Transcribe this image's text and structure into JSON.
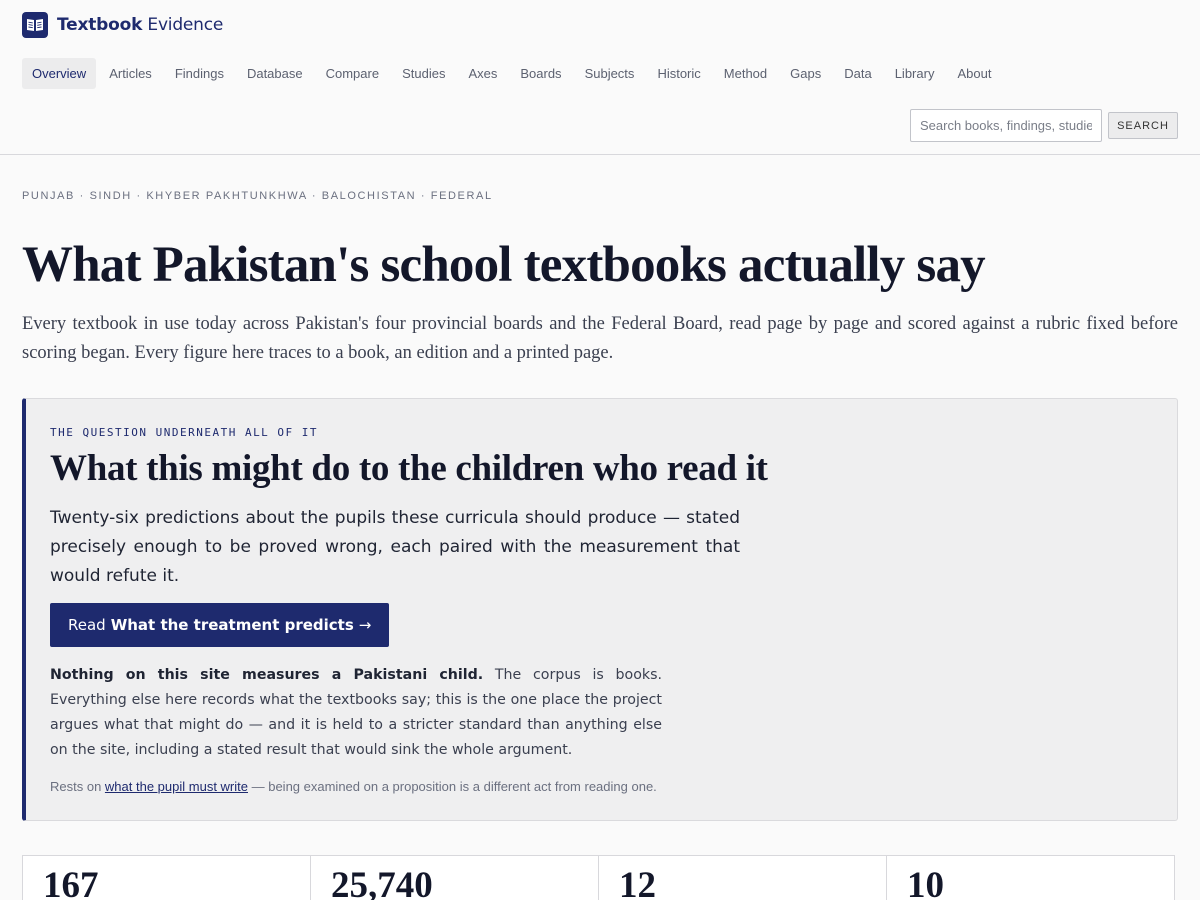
{
  "brand": {
    "name_bold": "Textbook",
    "name_light": " Evidence",
    "icon": "open-book-icon",
    "color": "#1e2a6e"
  },
  "nav": {
    "items": [
      {
        "label": "Overview",
        "active": true
      },
      {
        "label": "Articles"
      },
      {
        "label": "Findings"
      },
      {
        "label": "Database"
      },
      {
        "label": "Compare"
      },
      {
        "label": "Studies"
      },
      {
        "label": "Axes"
      },
      {
        "label": "Boards"
      },
      {
        "label": "Subjects"
      },
      {
        "label": "Historic"
      },
      {
        "label": "Method"
      },
      {
        "label": "Gaps"
      },
      {
        "label": "Data"
      },
      {
        "label": "Library"
      },
      {
        "label": "About"
      }
    ]
  },
  "search": {
    "placeholder": "Search books, findings, studies",
    "value": "",
    "button_label": "SEARCH"
  },
  "hero": {
    "eyebrow": "PUNJAB · SINDH · KHYBER PAKHTUNKHWA · BALOCHISTAN · FEDERAL",
    "title": "What Pakistan's school textbooks actually say",
    "lede": "Every textbook in use today across Pakistan's four provincial boards and the Federal Board, read page by page and scored against a rubric fixed before scoring began. Every figure here traces to a book, an edition and a printed page."
  },
  "feature": {
    "eyebrow": "THE QUESTION UNDERNEATH ALL OF IT",
    "title": "What this might do to the children who read it",
    "lede": "Twenty-six predictions about the pupils these curricula should produce — stated precisely enough to be proved wrong, each paired with the measurement that would refute it.",
    "cta_prefix": "Read",
    "cta_strong": "What the treatment predicts",
    "cta_arrow": "→",
    "body_strong": "Nothing on this site measures a Pakistani child.",
    "body_rest": " The corpus is books. Everything else here records what the textbooks say; this is the one place the project argues what that might do — and it is held to a stricter standard than anything else on the site, including a stated result that would sink the whole argument.",
    "note_prefix": "Rests on ",
    "note_link": "what the pupil must write",
    "note_suffix": " — being examined on a proposition is a different act from reading one."
  },
  "stats": [
    {
      "value": "167"
    },
    {
      "value": "25,740"
    },
    {
      "value": "12"
    },
    {
      "value": "10"
    }
  ]
}
